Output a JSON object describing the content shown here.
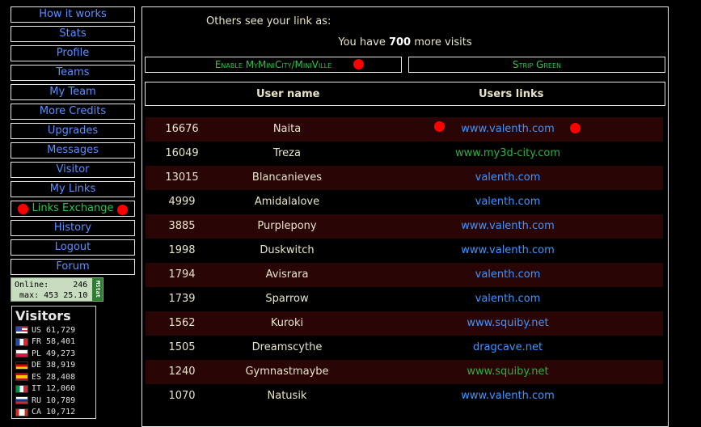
{
  "menu": [
    {
      "label": "How it works",
      "active": false
    },
    {
      "label": "Stats",
      "active": false
    },
    {
      "label": "Profile",
      "active": false
    },
    {
      "label": "Teams",
      "active": false
    },
    {
      "label": "My Team",
      "active": false
    },
    {
      "label": "More Credits",
      "active": false
    },
    {
      "label": "Upgrades",
      "active": false
    },
    {
      "label": "Messages",
      "active": false
    },
    {
      "label": "Visitor",
      "active": false
    },
    {
      "label": "My Links",
      "active": false
    },
    {
      "label": "Links Exchange",
      "active": true
    },
    {
      "label": "History",
      "active": false
    },
    {
      "label": "Logout",
      "active": false
    },
    {
      "label": "Forum",
      "active": false
    }
  ],
  "stats_box": {
    "online_label": "Online:",
    "online_value": "246",
    "max_label": "max:",
    "max_value": "453 25.10",
    "brand": "MStat"
  },
  "visitors": {
    "title": "Visitors",
    "rows": [
      {
        "code": "US",
        "count": "61,729",
        "flag": "us"
      },
      {
        "code": "FR",
        "count": "58,401",
        "flag": "fr"
      },
      {
        "code": "PL",
        "count": "49,273",
        "flag": "pl"
      },
      {
        "code": "DE",
        "count": "38,919",
        "flag": "de"
      },
      {
        "code": "ES",
        "count": "28,408",
        "flag": "es"
      },
      {
        "code": "IT",
        "count": "12,060",
        "flag": "it"
      },
      {
        "code": "RU",
        "count": "10,789",
        "flag": "ru"
      },
      {
        "code": "CA",
        "count": "10,712",
        "flag": "ca"
      }
    ]
  },
  "main": {
    "others_text": "Others see your link as:",
    "visits_prefix": "You have",
    "visits_count": "700",
    "visits_suffix": "more visits",
    "enable_button": "Enable MyMiniCity/MiniVille",
    "strip_button": "Strip Green",
    "col_user": "User name",
    "col_links": "Users links",
    "rows": [
      {
        "id": "16676",
        "name": "Naita",
        "link": "www.valenth.com",
        "green": false,
        "dots": true
      },
      {
        "id": "16049",
        "name": "Treza",
        "link": "www.my3d-city.com",
        "green": true,
        "dots": false
      },
      {
        "id": "13015",
        "name": "Blancanieves",
        "link": "valenth.com",
        "green": false,
        "dots": false
      },
      {
        "id": "4999",
        "name": "Amidalalove",
        "link": "valenth.com",
        "green": false,
        "dots": false
      },
      {
        "id": "3885",
        "name": "Purplepony",
        "link": "www.valenth.com",
        "green": false,
        "dots": false
      },
      {
        "id": "1998",
        "name": "Duskwitch",
        "link": "www.valenth.com",
        "green": false,
        "dots": false
      },
      {
        "id": "1794",
        "name": "Avisrara",
        "link": "valenth.com",
        "green": false,
        "dots": false
      },
      {
        "id": "1739",
        "name": "Sparrow",
        "link": "valenth.com",
        "green": false,
        "dots": false
      },
      {
        "id": "1562",
        "name": "Kuroki",
        "link": "www.squiby.net",
        "green": false,
        "dots": false
      },
      {
        "id": "1505",
        "name": "Dreamscythe",
        "link": "dragcave.net",
        "green": false,
        "dots": false
      },
      {
        "id": "1240",
        "name": "Gymnastmaybe",
        "link": "www.squiby.net",
        "green": true,
        "dots": false
      },
      {
        "id": "1070",
        "name": "Natusik",
        "link": "www.valenth.com",
        "green": false,
        "dots": false
      }
    ]
  },
  "colors": {
    "link_blue": "#3d95ff",
    "link_green": "#2fb040",
    "row_dark": "#2a0505",
    "dot_red": "#ff0000"
  }
}
